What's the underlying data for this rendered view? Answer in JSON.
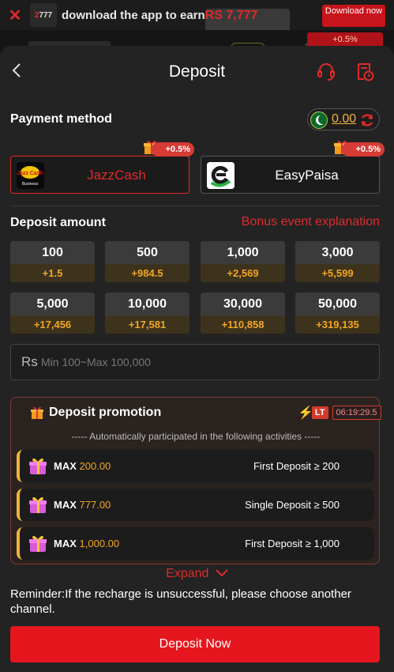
{
  "banner": {
    "logo_text": "777",
    "text": "download the app to earn",
    "amount": "RS 7,777",
    "download_label": "Download now"
  },
  "peek": {
    "dots": "...",
    "badge": "+0.5%"
  },
  "header": {
    "title": "Deposit"
  },
  "payment": {
    "label": "Payment method",
    "balance": "0.00",
    "methods": [
      {
        "name": "JazzCash",
        "bonus": "+0.5%",
        "selected": true
      },
      {
        "name": "EasyPaisa",
        "bonus": "+0.5%",
        "selected": false
      }
    ]
  },
  "deposit": {
    "label": "Deposit amount",
    "bonus_link": "Bonus event explanation",
    "amounts": [
      {
        "value": "100",
        "bonus": "+1.5"
      },
      {
        "value": "500",
        "bonus": "+984.5"
      },
      {
        "value": "1,000",
        "bonus": "+2,569"
      },
      {
        "value": "3,000",
        "bonus": "+5,599"
      },
      {
        "value": "5,000",
        "bonus": "+17,456"
      },
      {
        "value": "10,000",
        "bonus": "+17,581"
      },
      {
        "value": "30,000",
        "bonus": "+110,858"
      },
      {
        "value": "50,000",
        "bonus": "+319,135"
      }
    ],
    "currency": "Rs",
    "placeholder": "Min 100~Max 100,000"
  },
  "promotion": {
    "title": "Deposit promotion",
    "lt_label": "LT",
    "timer": "06:19:29.5",
    "subtitle": "----- Automatically participated in the following activities -----",
    "activities": [
      {
        "max_label": "MAX",
        "max_value": "200.00",
        "condition": "First Deposit ≥ 200"
      },
      {
        "max_label": "MAX",
        "max_value": "777.00",
        "condition": "Single Deposit ≥ 500"
      },
      {
        "max_label": "MAX",
        "max_value": "1,000.00",
        "condition": "First Deposit ≥ 1,000"
      }
    ]
  },
  "expand_label": "Expand",
  "reminder": "Reminder:If the recharge is unsuccessful, please choose another channel.",
  "submit_label": "Deposit Now"
}
